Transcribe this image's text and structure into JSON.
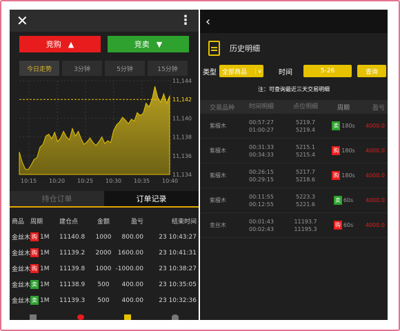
{
  "left": {
    "buy_label": "竞购",
    "sell_label": "竞卖",
    "time_tabs": [
      "今日走势",
      "3分钟",
      "5分钟",
      "15分钟"
    ],
    "subtabs": [
      "持仓订单",
      "订单记录"
    ],
    "table_headers": [
      "商品",
      "周期",
      "建仓点",
      "金额",
      "盈亏",
      "结束时间"
    ],
    "orders": [
      {
        "product": "金丝木",
        "dir": "购",
        "period": "1M",
        "open": "11140.8",
        "amount": "1000",
        "pnl": "800.00",
        "end": "23 10:43:27"
      },
      {
        "product": "金丝木",
        "dir": "购",
        "period": "1M",
        "open": "11139.2",
        "amount": "2000",
        "pnl": "1600.00",
        "end": "23 10:41:31"
      },
      {
        "product": "金丝木",
        "dir": "购",
        "period": "1M",
        "open": "11139.8",
        "amount": "1000",
        "pnl": "-1000.00",
        "end": "23 10:38:27"
      },
      {
        "product": "金丝木",
        "dir": "卖",
        "period": "1M",
        "open": "11138.9",
        "amount": "500",
        "pnl": "400.00",
        "end": "23 10:35:05"
      },
      {
        "product": "金丝木",
        "dir": "卖",
        "period": "1M",
        "open": "11139.3",
        "amount": "500",
        "pnl": "400.00",
        "end": "23 10:32:36"
      }
    ]
  },
  "chart_data": {
    "type": "area",
    "x_labels": [
      "10:15",
      "10:20",
      "10:25",
      "10:30",
      "10:35",
      "10:40"
    ],
    "ylim": [
      11134,
      11144
    ],
    "y_ticks": [
      "11,144",
      "11,142",
      "11,140",
      "11,138",
      "11,136",
      "11,134"
    ],
    "current_price": "11,142",
    "values": [
      11136.4,
      11135.3,
      11134.6,
      11134.5,
      11135.0,
      11135.6,
      11135.8,
      11136.9,
      11137.2,
      11138.1,
      11138.3,
      11137.8,
      11138.5,
      11137.5,
      11137.9,
      11138.6,
      11138.0,
      11137.7,
      11138.9,
      11138.1,
      11138.6,
      11137.8,
      11137.2,
      11137.5,
      11137.9,
      11137.4,
      11137.1,
      11137.5,
      11138.0,
      11137.3,
      11137.6,
      11137.4,
      11138.7,
      11139.3,
      11139.6,
      11140.1,
      11139.8,
      11139.4,
      11139.9,
      11139.7,
      11140.6,
      11140.3,
      11140.5,
      11141.6,
      11141.2,
      11142.0,
      11143.4,
      11142.2,
      11141.7,
      11142.6,
      11141.6,
      11142.4
    ]
  },
  "right": {
    "back": "‹",
    "title": "历史明细",
    "type_label": "类型",
    "type_value": "全部商品",
    "time_label": "时间",
    "date_value": "5-26",
    "query_label": "查询",
    "note": "注：可查询最近三天交易明细",
    "headers": [
      "交易品种",
      "时间明细",
      "点位明细",
      "周期",
      "盈亏"
    ],
    "rows": [
      {
        "product": "紫檀木",
        "t1": "00:57:27",
        "t2": "01:00:27",
        "p1": "5219.7",
        "p2": "5219.4",
        "dir": "卖",
        "period": "180s",
        "pnl": "4000.0"
      },
      {
        "product": "紫檀木",
        "t1": "00:31:33",
        "t2": "00:34:33",
        "p1": "5215.1",
        "p2": "5215.4",
        "dir": "购",
        "period": "180s",
        "pnl": "4000.0"
      },
      {
        "product": "紫檀木",
        "t1": "00:26:15",
        "t2": "00:29:15",
        "p1": "5217.7",
        "p2": "5218.6",
        "dir": "购",
        "period": "180s",
        "pnl": "4000.0"
      },
      {
        "product": "紫檀木",
        "t1": "00:11:55",
        "t2": "00:12:55",
        "p1": "5223.3",
        "p2": "5221.6",
        "dir": "卖",
        "period": "60s",
        "pnl": "4000.0"
      },
      {
        "product": "金丝木",
        "t1": "00:01:43",
        "t2": "00:02:43",
        "p1": "11193.7",
        "p2": "11195.3",
        "dir": "购",
        "period": "60s",
        "pnl": "4000.0"
      }
    ]
  },
  "colors": {
    "buy": "#e81c1c",
    "sell": "#2ea12e",
    "accent": "#e6c200",
    "area": "#b8a020"
  }
}
